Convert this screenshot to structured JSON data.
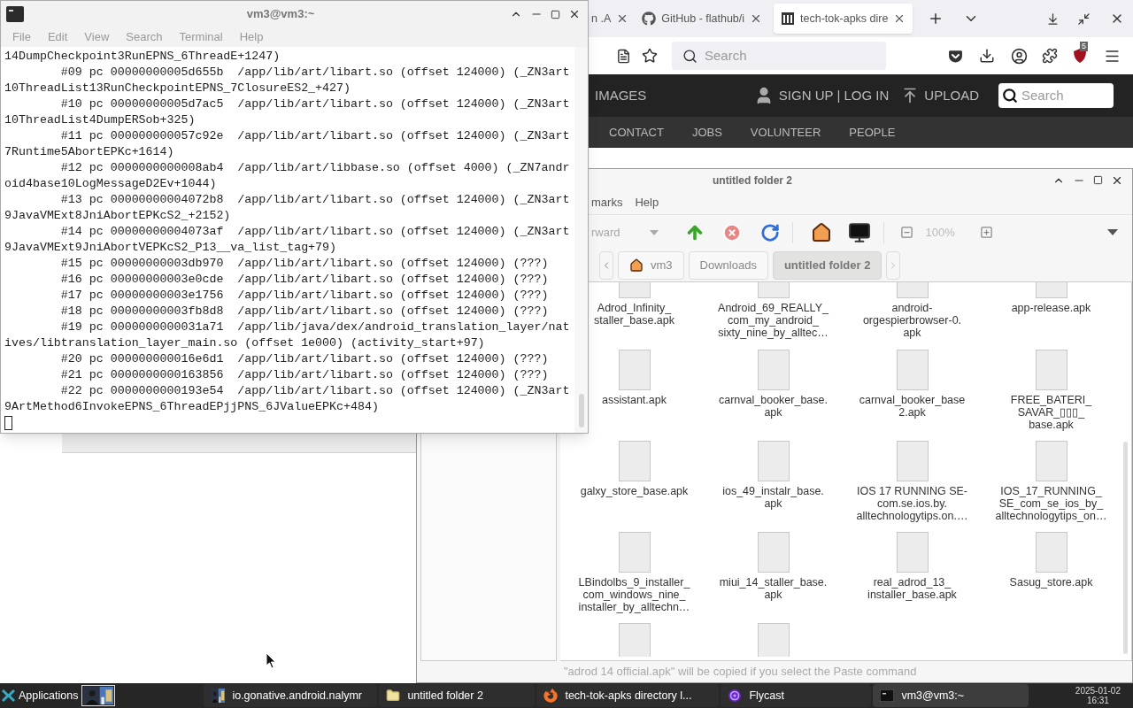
{
  "browser": {
    "tabs": [
      {
        "label": "n .A",
        "selected": false
      },
      {
        "label": "GitHub - flathub/i",
        "selected": false,
        "kind": "github"
      },
      {
        "label": "tech-tok-apks dire",
        "selected": true,
        "kind": "archive"
      }
    ],
    "address_search": {
      "placeholder": "Search"
    },
    "extension_badge": "5",
    "site": {
      "images": "IMAGES",
      "account": "SIGN UP | LOG IN",
      "upload": "UPLOAD",
      "search": {
        "placeholder": "Search"
      },
      "nav": [
        {
          "label": "CONTACT"
        },
        {
          "label": "JOBS"
        },
        {
          "label": "VOLUNTEER"
        },
        {
          "label": "PEOPLE"
        }
      ]
    }
  },
  "file_manager": {
    "title": "untitled folder 2",
    "menu": [
      "marks",
      "Help"
    ],
    "back_label": "rward",
    "zoom": "100%",
    "breadcrumbs": [
      {
        "label": "vm3",
        "selected": false,
        "kind": "home"
      },
      {
        "label": "Downloads",
        "selected": false
      },
      {
        "label": "untitled folder 2",
        "selected": true
      }
    ],
    "files": [
      {
        "kind": "top-cut",
        "name_lines": [
          "Adrod_Infinity_",
          "staller_base.apk"
        ]
      },
      {
        "kind": "top-cut",
        "name_lines": [
          "Android_69_REALLY_",
          "com_my_android_",
          "sixty_nine_by_alltec…"
        ]
      },
      {
        "kind": "top-cut",
        "name_lines": [
          "android-",
          "orgespierbrowser-0.",
          "apk"
        ]
      },
      {
        "kind": "top-cut",
        "name_lines": [
          "app-release.apk"
        ]
      },
      {
        "kind": "full",
        "name_lines": [
          "assistant.apk"
        ]
      },
      {
        "kind": "full",
        "name_lines": [
          "carnval_booker_base.",
          "apk"
        ]
      },
      {
        "kind": "full",
        "name_lines": [
          "carnval_booker_base",
          "2.apk"
        ]
      },
      {
        "kind": "full",
        "name_lines": [
          "FREE_BATERI_",
          "SAVAR_▯▯▯_",
          "base.apk"
        ]
      },
      {
        "kind": "full",
        "name_lines": [
          "galxy_store_base.apk"
        ]
      },
      {
        "kind": "full",
        "name_lines": [
          "ios_49_instalr_base.",
          "apk"
        ]
      },
      {
        "kind": "full",
        "name_lines": [
          "IOS 17 RUNNING SE-",
          "com.se.ios.by.",
          "alltechnologytips.on.…"
        ]
      },
      {
        "kind": "full",
        "name_lines": [
          "IOS_17_RUNNING_",
          "SE_com_se_ios_by_",
          "alltechnologytips_on…"
        ]
      },
      {
        "kind": "full",
        "name_lines": [
          "LBindolbs_9_installer_",
          "com_windows_nine_",
          "installer_by_alltechn…"
        ]
      },
      {
        "kind": "full",
        "name_lines": [
          "miui_14_staller_base.",
          "apk"
        ]
      },
      {
        "kind": "full",
        "name_lines": [
          "real_adrod_13_",
          "installer_base.apk"
        ]
      },
      {
        "kind": "full",
        "name_lines": [
          "Sasug_store.apk"
        ]
      },
      {
        "kind": "bottom-cut"
      },
      {
        "kind": "bottom-cut"
      }
    ],
    "status": "\"adrod 14 official.apk\" will be copied if you select the Paste command"
  },
  "terminal": {
    "title": "vm3@vm3:~",
    "menu": [
      "File",
      "Edit",
      "View",
      "Search",
      "Terminal",
      "Help"
    ],
    "lines": [
      "14DumpCheckpoint3RunEPNS_6ThreadE+1247)",
      "        #09 pc 00000000005d655b  /app/lib/art/libart.so (offset 124000) (_ZN3art",
      "10ThreadList13RunCheckpointEPNS_7ClosureES2_+427)",
      "        #10 pc 00000000005d7ac5  /app/lib/art/libart.so (offset 124000) (_ZN3art",
      "10ThreadList4DumpERSob+325)",
      "        #11 pc 000000000057c92e  /app/lib/art/libart.so (offset 124000) (_ZN3art",
      "7Runtime5AbortEPKc+1614)",
      "        #12 pc 0000000000008ab4  /app/lib/art/libbase.so (offset 4000) (_ZN7andr",
      "oid4base10LogMessageD2Ev+1044)",
      "        #13 pc 00000000004072b8  /app/lib/art/libart.so (offset 124000) (_ZN3art",
      "9JavaVMExt8JniAbortEPKcS2_+2152)",
      "        #14 pc 00000000004073af  /app/lib/art/libart.so (offset 124000) (_ZN3art",
      "9JavaVMExt9JniAbortVEPKcS2_P13__va_list_tag+79)",
      "        #15 pc 00000000003db970  /app/lib/art/libart.so (offset 124000) (???)",
      "        #16 pc 00000000003e0cde  /app/lib/art/libart.so (offset 124000) (???)",
      "        #17 pc 00000000003e1756  /app/lib/art/libart.so (offset 124000) (???)",
      "        #18 pc 00000000003fb8d8  /app/lib/art/libart.so (offset 124000) (???)",
      "        #19 pc 0000000000031a71  /app/lib/java/dex/android_translation_layer/nat",
      "ives/libtranslation_layer_main.so (offset 1e000) (activity_start+97)",
      "        #20 pc 000000000016e6d1  /app/lib/art/libart.so (offset 124000) (???)",
      "        #21 pc 0000000000163856  /app/lib/art/libart.so (offset 124000) (???)",
      "        #22 pc 0000000000193e54  /app/lib/art/libart.so (offset 124000) (_ZN3art",
      "9ArtMethod6InvokeEPNS_6ThreadEPjjPNS_6JValueEPKc+484)"
    ]
  },
  "taskbar": {
    "menu_label": "Applications",
    "tasks": [
      {
        "label": "io.gonative.android.nalymr",
        "selected": false
      },
      {
        "label": "untitled folder 2",
        "selected": false,
        "kind": "folder"
      },
      {
        "label": "tech-tok-apks directory l...",
        "selected": false,
        "kind": "firefox"
      },
      {
        "label": "Flycast",
        "selected": false,
        "kind": "flycast"
      },
      {
        "label": "vm3@vm3:~",
        "selected": true,
        "kind": "terminal"
      }
    ],
    "clock": {
      "date": "2025-01-02",
      "time": "16:31"
    }
  }
}
